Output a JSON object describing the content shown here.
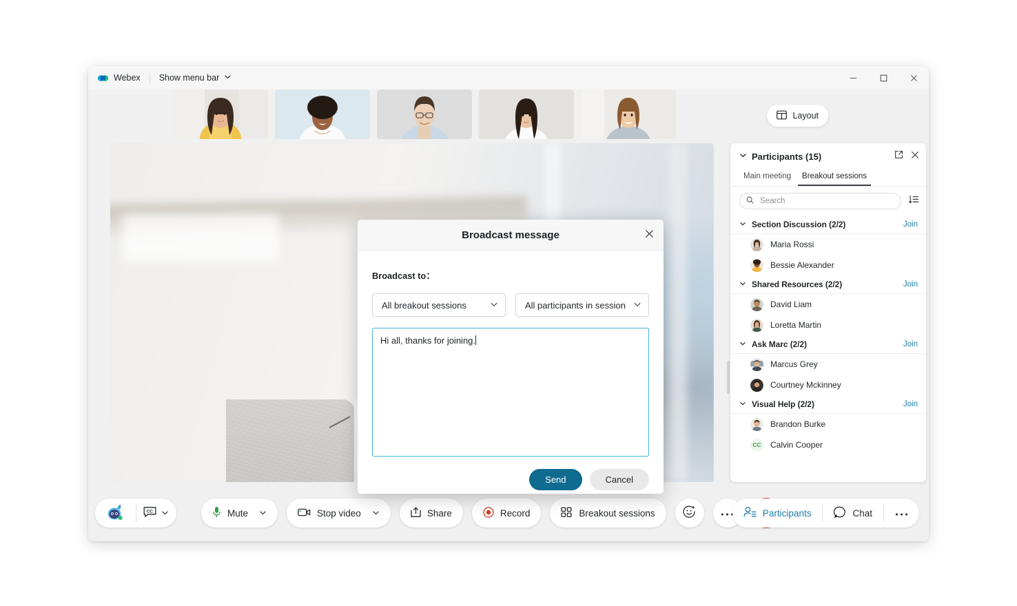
{
  "titlebar": {
    "brand": "Webex",
    "menu_label": "Show menu bar",
    "logo_icon": "webex-logo-icon",
    "chevron_icon": "chevron-down-icon",
    "minimize_icon": "minimize-icon",
    "maximize_icon": "maximize-icon",
    "close_icon": "close-icon"
  },
  "filmstrip": {
    "layout_label": "Layout",
    "layout_icon": "layout-grid-icon",
    "thumbnails": [
      {
        "name": "participant-thumbnail-1"
      },
      {
        "name": "participant-thumbnail-2"
      },
      {
        "name": "participant-thumbnail-3"
      },
      {
        "name": "participant-thumbnail-4"
      },
      {
        "name": "participant-thumbnail-5"
      }
    ]
  },
  "panel": {
    "title": "Participants (15)",
    "collapse_icon": "chevron-down-icon",
    "popout_icon": "pop-out-icon",
    "close_icon": "close-icon",
    "sort_icon": "sort-icon",
    "tabs": [
      {
        "label": "Main meeting",
        "active": false
      },
      {
        "label": "Breakout sessions",
        "active": true
      }
    ],
    "search": {
      "placeholder": "Search",
      "value": "",
      "icon": "search-icon"
    },
    "join_label": "Join",
    "groups": [
      {
        "name": "Section Discussion (2/2)",
        "join": "Join",
        "participants": [
          {
            "name": "Maria Rossi",
            "avatar_type": "photo",
            "avatar_color": "#d8c9bf"
          },
          {
            "name": "Bessie Alexander",
            "avatar_type": "photo",
            "avatar_color": "#b97c4a"
          }
        ]
      },
      {
        "name": "Shared Resources (2/2)",
        "join": "Join",
        "participants": [
          {
            "name": "David Liam",
            "avatar_type": "photo",
            "avatar_color": "#a8734f"
          },
          {
            "name": "Loretta Martin",
            "avatar_type": "photo",
            "avatar_color": "#8d6244"
          }
        ]
      },
      {
        "name": "Ask Marc (2/2)",
        "join": "Join",
        "participants": [
          {
            "name": "Marcus Grey",
            "avatar_type": "photo",
            "avatar_color": "#7f8f9c"
          },
          {
            "name": "Courtney Mckinney",
            "avatar_type": "photo",
            "avatar_color": "#4a3a33"
          }
        ]
      },
      {
        "name": "Visual Help (2/2)",
        "join": "Join",
        "participants": [
          {
            "name": "Brandon Burke",
            "avatar_type": "photo",
            "avatar_color": "#c3a187"
          },
          {
            "name": "Calvin Cooper",
            "avatar_type": "initials",
            "initials": "CC",
            "avatar_color": "#edf6ec"
          }
        ]
      }
    ]
  },
  "modal": {
    "title": "Broadcast message",
    "close_icon": "close-icon",
    "field_label": "Broadcast to：",
    "session_select": {
      "value": "All breakout sessions",
      "caret_icon": "chevron-down-icon"
    },
    "audience_select": {
      "value": "All participants in session",
      "caret_icon": "chevron-down-icon"
    },
    "message": {
      "value": "Hi all, thanks for joining.",
      "placeholder": ""
    },
    "send_label": "Send",
    "cancel_label": "Cancel"
  },
  "controlbar": {
    "assistant_icon": "webex-assistant-icon",
    "captions_icon": "closed-captions-icon",
    "captions_caret_icon": "chevron-down-icon",
    "buttons": [
      {
        "label": "Mute",
        "icon": "microphone-icon",
        "caret": true
      },
      {
        "label": "Stop video",
        "icon": "camera-icon",
        "caret": true
      },
      {
        "label": "Share",
        "icon": "share-up-icon",
        "caret": false
      },
      {
        "label": "Record",
        "icon": "record-icon",
        "caret": false
      },
      {
        "label": "Breakout sessions",
        "icon": "breakout-grid-icon",
        "caret": false
      }
    ],
    "reactions_icon": "emoji-smile-icon",
    "more_icon": "more-horizontal-icon",
    "end_icon": "end-call-x-icon",
    "right": {
      "participants_label": "Participants",
      "participants_icon": "participants-icon",
      "chat_label": "Chat",
      "chat_icon": "chat-bubble-icon",
      "more_icon": "more-horizontal-icon"
    }
  },
  "colors": {
    "accent": "#1a7ea8",
    "primary_button": "#0f6b8f",
    "end_call": "#d3371e",
    "focus_border": "#3fb3e0",
    "record_red": "#d3371e",
    "mic_green": "#3aa655"
  }
}
